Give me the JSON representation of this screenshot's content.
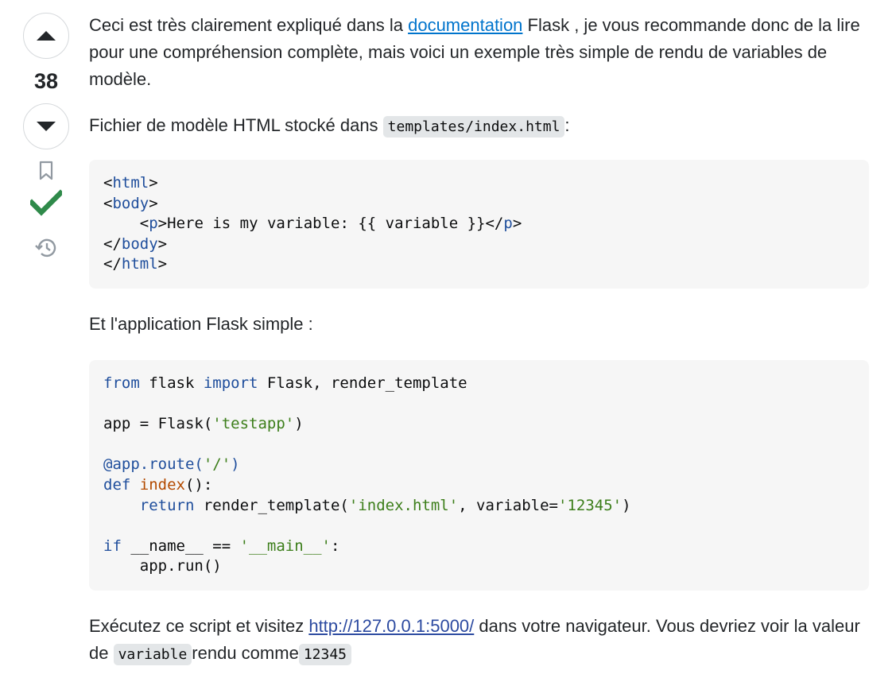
{
  "vote": {
    "count": "38"
  },
  "post": {
    "p1_before": "Ceci est très clairement expliqué dans la ",
    "p1_link": "documentation",
    "p1_after": " Flask , je vous recommande donc de la lire pour une compréhension complète, mais voici un exemple très simple de rendu de variables de modèle.",
    "p2_before": "Fichier de modèle HTML stocké dans ",
    "p2_code": "templates/index.html",
    "p2_after": ":",
    "html_code": [
      {
        "indent": "",
        "open": "<",
        "tag": "html",
        "close": ">",
        "rest": ""
      },
      {
        "indent": "",
        "open": "<",
        "tag": "body",
        "close": ">",
        "rest": ""
      },
      {
        "indent": "    ",
        "open": "<",
        "tag": "p",
        "close": ">",
        "rest": "Here is my variable: {{ variable }}</",
        "tag2": "p",
        "close2": ">"
      },
      {
        "indent": "",
        "open": "</",
        "tag": "body",
        "close": ">",
        "rest": ""
      },
      {
        "indent": "",
        "open": "</",
        "tag": "html",
        "close": ">",
        "rest": ""
      }
    ],
    "p3": "Et l'application Flask simple :",
    "python_code": {
      "l1_kw1": "from",
      "l1_mid": " flask ",
      "l1_kw2": "import",
      "l1_rest": " Flask, render_template",
      "l3_a": "app = Flask(",
      "l3_str": "'testapp'",
      "l3_b": ")",
      "l5_dec": "@app.route(",
      "l5_str": "'/'",
      "l5_b": ")",
      "l6_kw": "def",
      "l6_fn": " index",
      "l6_b": "():",
      "l7_indent": "    ",
      "l7_kw": "return",
      "l7_a": " render_template(",
      "l7_str1": "'index.html'",
      "l7_b": ", variable=",
      "l7_str2": "'12345'",
      "l7_c": ")",
      "l9_kw": "if",
      "l9_a": " __name__ == ",
      "l9_str": "'__main__'",
      "l9_b": ":",
      "l10": "    app.run()"
    },
    "p4_before": "Exécutez ce script et visitez ",
    "p4_link": "http://127.0.0.1:5000/",
    "p4_mid": " dans votre navigateur. Vous devriez voir la valeur de ",
    "p4_code1": "variable",
    "p4_mid2": "rendu comme",
    "p4_code2": "12345"
  },
  "colors": {
    "accepted": "#2f8a4a",
    "link": "#0074cc",
    "keyword": "#1f4e9c",
    "string": "#3c7e1a",
    "function": "#b34a00"
  }
}
